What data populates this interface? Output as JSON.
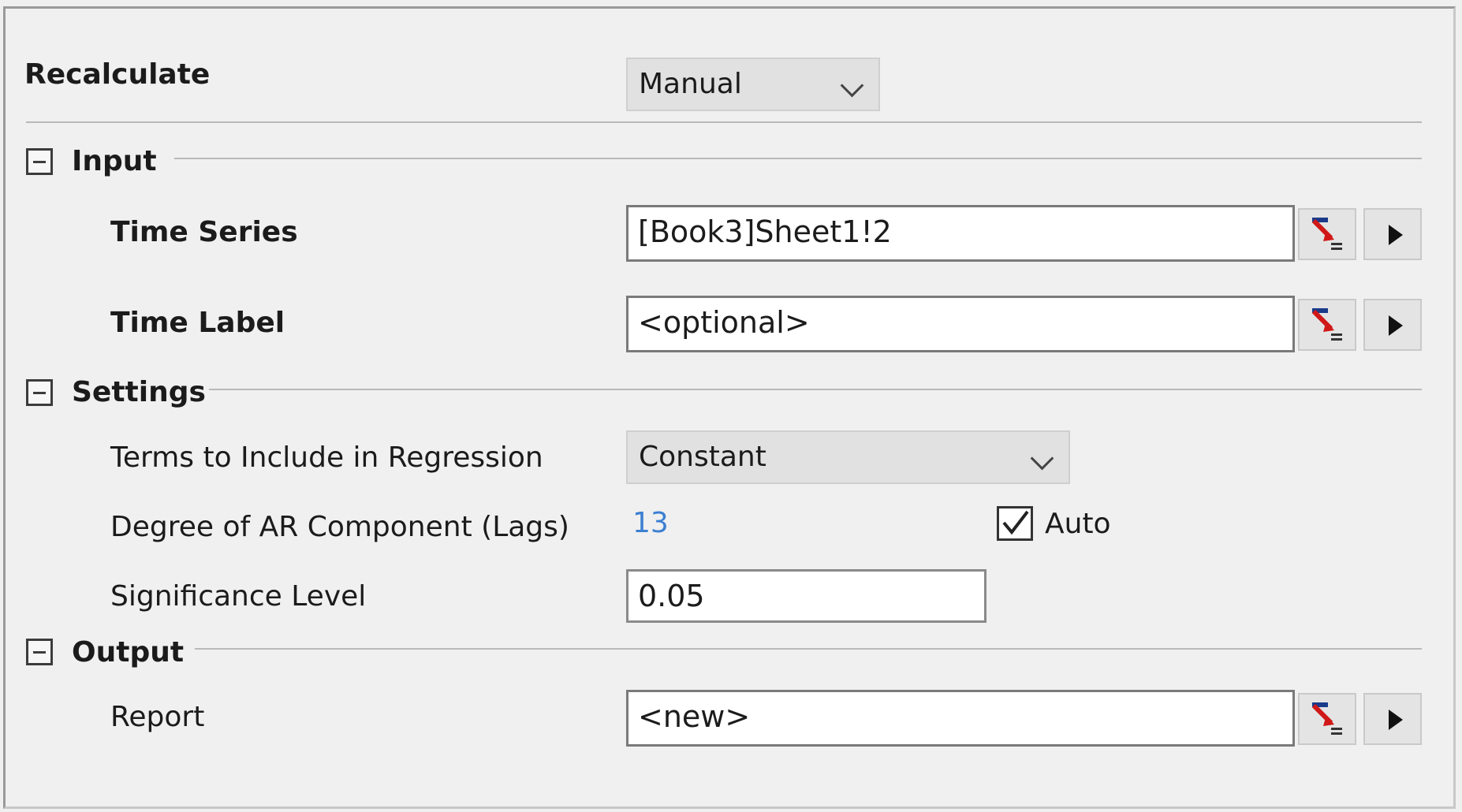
{
  "recalculate": {
    "label": "Recalculate",
    "value": "Manual"
  },
  "input": {
    "title": "Input",
    "time_series": {
      "label": "Time Series",
      "value": "[Book3]Sheet1!2"
    },
    "time_label": {
      "label": "Time Label",
      "value": "<optional>"
    }
  },
  "settings": {
    "title": "Settings",
    "terms": {
      "label": "Terms to Include in Regression",
      "value": "Constant"
    },
    "degree": {
      "label": "Degree of AR Component (Lags)",
      "value": "13",
      "value_color": "#3b7fd1",
      "auto_label": "Auto",
      "auto_checked": true
    },
    "significance": {
      "label": "Significance Level",
      "value": "0.05"
    }
  },
  "output": {
    "title": "Output",
    "report": {
      "label": "Report",
      "value": "<new>"
    }
  },
  "icons": {
    "range_select": "range-select-icon",
    "arrow": "triangle-right-icon",
    "collapse": "minus-box-icon",
    "dropdown": "chevron-down-icon"
  }
}
